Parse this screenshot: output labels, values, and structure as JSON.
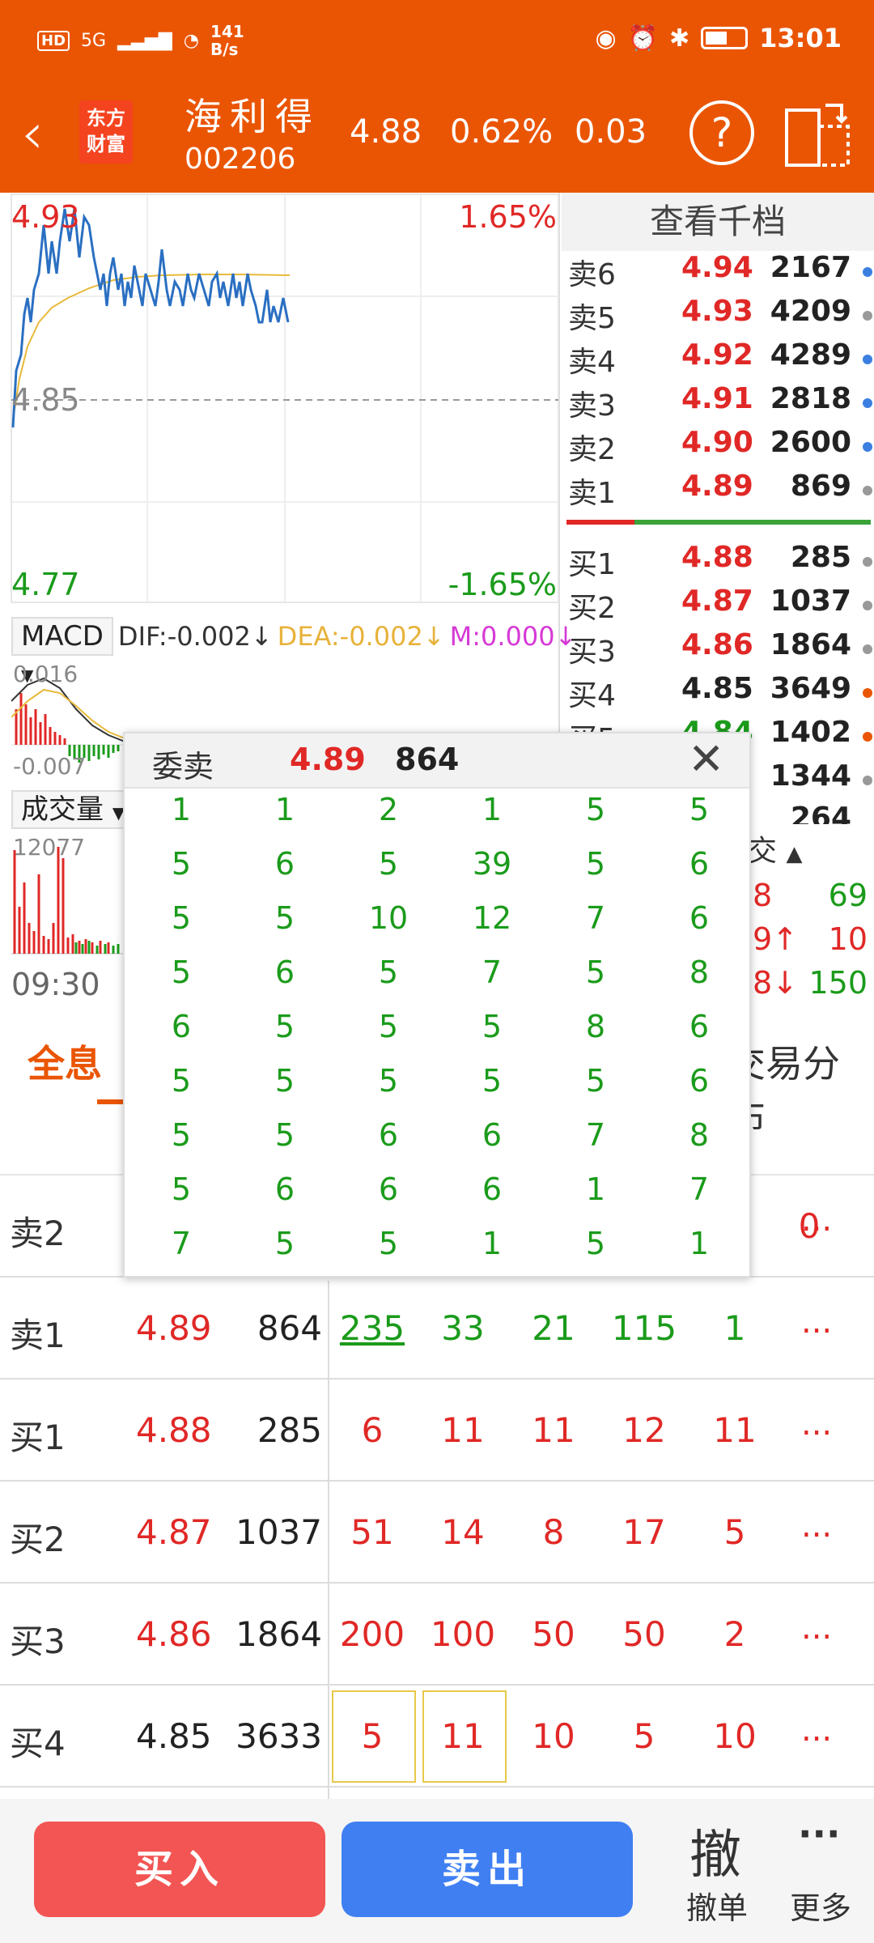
{
  "status_bar": {
    "hd": "HD",
    "net": "5G",
    "speed_value": "141",
    "speed_unit": "B/s",
    "time": "13:01"
  },
  "header": {
    "logo_line1": "东方",
    "logo_line2": "财富",
    "stock_name": "海利得",
    "stock_code": "002206",
    "price": "4.88",
    "change_pct": "0.62%",
    "change": "0.03",
    "help": "?"
  },
  "chart": {
    "high": "4.93",
    "high_pct": "1.65%",
    "mid": "4.85",
    "low": "4.77",
    "low_pct": "-1.65%",
    "macd_selector": "MACD",
    "dif": "DIF:-0.002",
    "dea": "DEA:-0.002",
    "m": "M:0.000",
    "macd_top": "0.016",
    "macd_bottom": "-0.007",
    "volume_selector": "成交量",
    "volume_max": "12077",
    "time_start": "09:30"
  },
  "order_book": {
    "title": "查看千档",
    "asks": [
      {
        "label": "卖6",
        "price": "4.94",
        "vol": "2167",
        "dot": "#3b7fe0"
      },
      {
        "label": "卖5",
        "price": "4.93",
        "vol": "4209",
        "dot": "#999999"
      },
      {
        "label": "卖4",
        "price": "4.92",
        "vol": "4289",
        "dot": "#3b7fe0"
      },
      {
        "label": "卖3",
        "price": "4.91",
        "vol": "2818",
        "dot": "#3b7fe0"
      },
      {
        "label": "卖2",
        "price": "4.90",
        "vol": "2600",
        "dot": "#3b7fe0"
      },
      {
        "label": "卖1",
        "price": "4.89",
        "vol": "869",
        "dot": "#999999"
      }
    ],
    "bids": [
      {
        "label": "买1",
        "price": "4.88",
        "vol": "285",
        "dot": "#999999"
      },
      {
        "label": "买2",
        "price": "4.87",
        "vol": "1037",
        "dot": "#999999"
      },
      {
        "label": "买3",
        "price": "4.86",
        "vol": "1864",
        "dot": "#999999"
      },
      {
        "label": "买4",
        "price": "4.85",
        "vol": "3649",
        "dot": "#ea5504"
      },
      {
        "label": "买5",
        "price": "4.84",
        "vol": "1402",
        "dot": "#ea5504"
      },
      {
        "label": "",
        "price": "",
        "vol": "1344",
        "dot": "#999999"
      }
    ],
    "partial_vol": "264"
  },
  "trades": {
    "header": "交",
    "rows": [
      {
        "price": "8",
        "vol": "69"
      },
      {
        "price": "9↑",
        "vol": "10"
      },
      {
        "price": "8↓",
        "vol": "150"
      }
    ]
  },
  "tabs": {
    "active": "全息",
    "other": "交易分布"
  },
  "queue_rows": [
    {
      "label": "卖2",
      "price": "",
      "vol": "",
      "q": [
        "",
        "",
        "",
        "",
        ""
      ],
      "tail": "0"
    },
    {
      "label": "卖1",
      "price": "4.89",
      "vol": "864",
      "q": [
        "235",
        "33",
        "21",
        "115",
        "1"
      ]
    },
    {
      "label": "买1",
      "price": "4.88",
      "vol": "285",
      "q": [
        "6",
        "11",
        "11",
        "12",
        "11"
      ]
    },
    {
      "label": "买2",
      "price": "4.87",
      "vol": "1037",
      "q": [
        "51",
        "14",
        "8",
        "17",
        "5"
      ]
    },
    {
      "label": "买3",
      "price": "4.86",
      "vol": "1864",
      "q": [
        "200",
        "100",
        "50",
        "50",
        "2"
      ]
    },
    {
      "label": "买4",
      "price": "4.85",
      "vol": "3633",
      "q": [
        "5",
        "11",
        "10",
        "5",
        "10"
      ]
    }
  ],
  "more_text": "...",
  "popup": {
    "title": "委卖",
    "price": "4.89",
    "vol": "864",
    "close": "✕",
    "cells": [
      [
        "1",
        "1",
        "2",
        "1",
        "5",
        "5"
      ],
      [
        "5",
        "6",
        "5",
        "39",
        "5",
        "6"
      ],
      [
        "5",
        "5",
        "10",
        "12",
        "7",
        "6"
      ],
      [
        "5",
        "6",
        "5",
        "7",
        "5",
        "8"
      ],
      [
        "6",
        "5",
        "5",
        "5",
        "8",
        "6"
      ],
      [
        "5",
        "5",
        "5",
        "5",
        "5",
        "6"
      ],
      [
        "5",
        "5",
        "6",
        "6",
        "7",
        "8"
      ],
      [
        "5",
        "6",
        "6",
        "6",
        "1",
        "7"
      ],
      [
        "7",
        "5",
        "5",
        "1",
        "5",
        "1"
      ]
    ]
  },
  "bottom_bar": {
    "buy": "买入",
    "sell": "卖出",
    "cancel_icon": "撤",
    "cancel": "撤单",
    "more_icon": "···",
    "more": "更多"
  }
}
